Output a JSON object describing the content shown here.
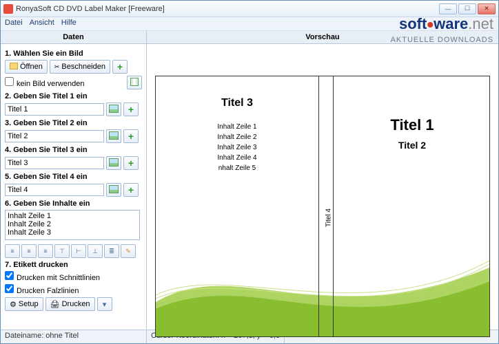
{
  "window": {
    "title": "RonyaSoft CD DVD Label Maker [Freeware]"
  },
  "menu": {
    "datei": "Datei",
    "ansicht": "Ansicht",
    "hilfe": "Hilfe"
  },
  "headers": {
    "left": "Daten",
    "right": "Vorschau"
  },
  "sect1": {
    "title": "1. Wählen Sie ein Bild",
    "open": "Öffnen",
    "crop": "Beschneiden",
    "nobild": "kein Bild verwenden"
  },
  "sect2": {
    "title": "2. Geben Sie Titel 1 ein",
    "value": "Titel 1"
  },
  "sect3": {
    "title": "3. Geben Sie Titel 2 ein",
    "value": "Titel 2"
  },
  "sect4": {
    "title": "4. Geben Sie Titel 3 ein",
    "value": "Titel 3"
  },
  "sect5": {
    "title": "5. Geben Sie Titel 4 ein",
    "value": "Titel 4"
  },
  "sect6": {
    "title": "6. Geben Sie Inhalte ein",
    "value": "Inhalt Zeile 1\nInhalt Zeile 2\nInhalt Zeile 3"
  },
  "sect7": {
    "title": "7. Etikett drucken",
    "cut": "Drucken mit Schnittlinien",
    "fold": "Drucken Falzlinien",
    "setup": "Setup",
    "print": "Drucken"
  },
  "preview": {
    "titel1": "Titel 1",
    "titel2": "Titel 2",
    "titel3": "Titel 3",
    "titel4": "Titel 4",
    "lines": [
      "Inhalt Zeile 1",
      "Inhalt  Zeile 2",
      "Inhalt Zeile 3",
      "Inhalt Zeile 4",
      "nhalt Zeile 5"
    ]
  },
  "status": {
    "filename": "Dateiname: ohne Titel",
    "cursor": "Cursor-Koordinaten: x = 267,8; y =   0,0"
  },
  "watermark": {
    "logo1": "soft",
    "logo2": "ware",
    "logo3": ".net",
    "sub": "AKTUELLE DOWNLOADS"
  }
}
